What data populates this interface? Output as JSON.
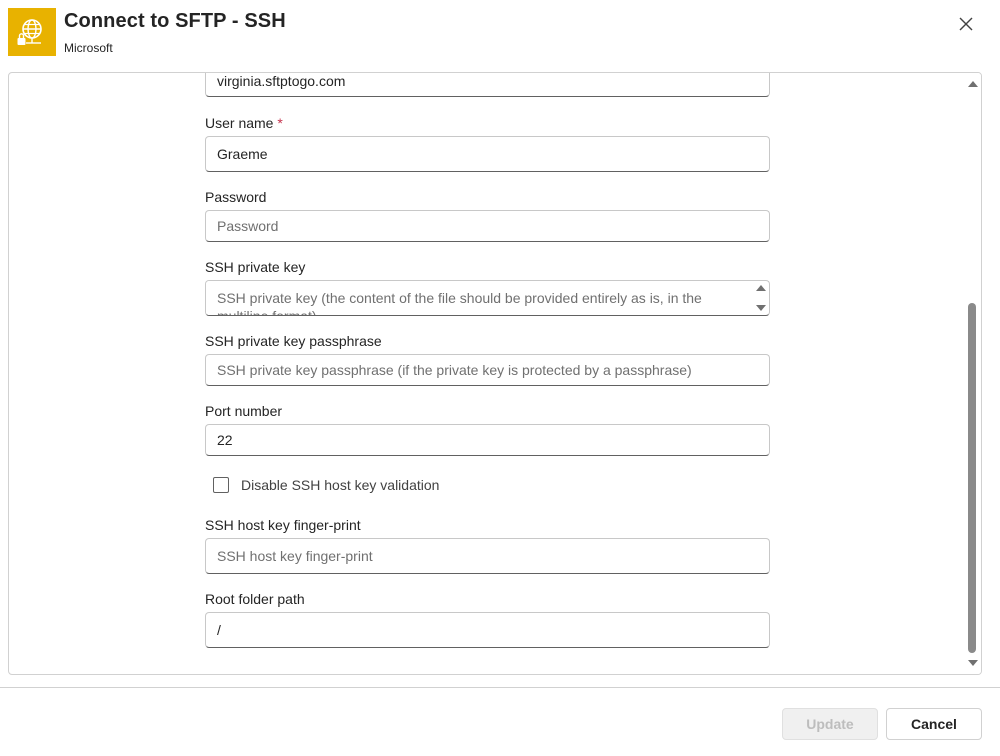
{
  "dialog": {
    "title": "Connect to SFTP - SSH",
    "subtitle": "Microsoft",
    "icon": "sftp-connector-icon",
    "accent_color": "#e8b200"
  },
  "fields": {
    "host": {
      "value": "virginia.sftptogo.com"
    },
    "username": {
      "label": "User name",
      "required_mark": "*",
      "value": "Graeme"
    },
    "password": {
      "label": "Password",
      "placeholder": "Password",
      "value": ""
    },
    "ssh_private_key": {
      "label": "SSH private key",
      "placeholder": "SSH private key (the content of the file should be provided entirely as is, in the multiline format)",
      "value": ""
    },
    "passphrase": {
      "label": "SSH private key passphrase",
      "placeholder": "SSH private key passphrase (if the private key is protected by a passphrase)",
      "value": ""
    },
    "port": {
      "label": "Port number",
      "value": "22"
    },
    "disable_host_key_validation": {
      "label": "Disable SSH host key validation",
      "checked": false
    },
    "host_key_fingerprint": {
      "label": "SSH host key finger-print",
      "placeholder": "SSH host key finger-print",
      "value": ""
    },
    "root_folder": {
      "label": "Root folder path",
      "value": "/"
    }
  },
  "footer": {
    "update_label": "Update",
    "cancel_label": "Cancel"
  }
}
